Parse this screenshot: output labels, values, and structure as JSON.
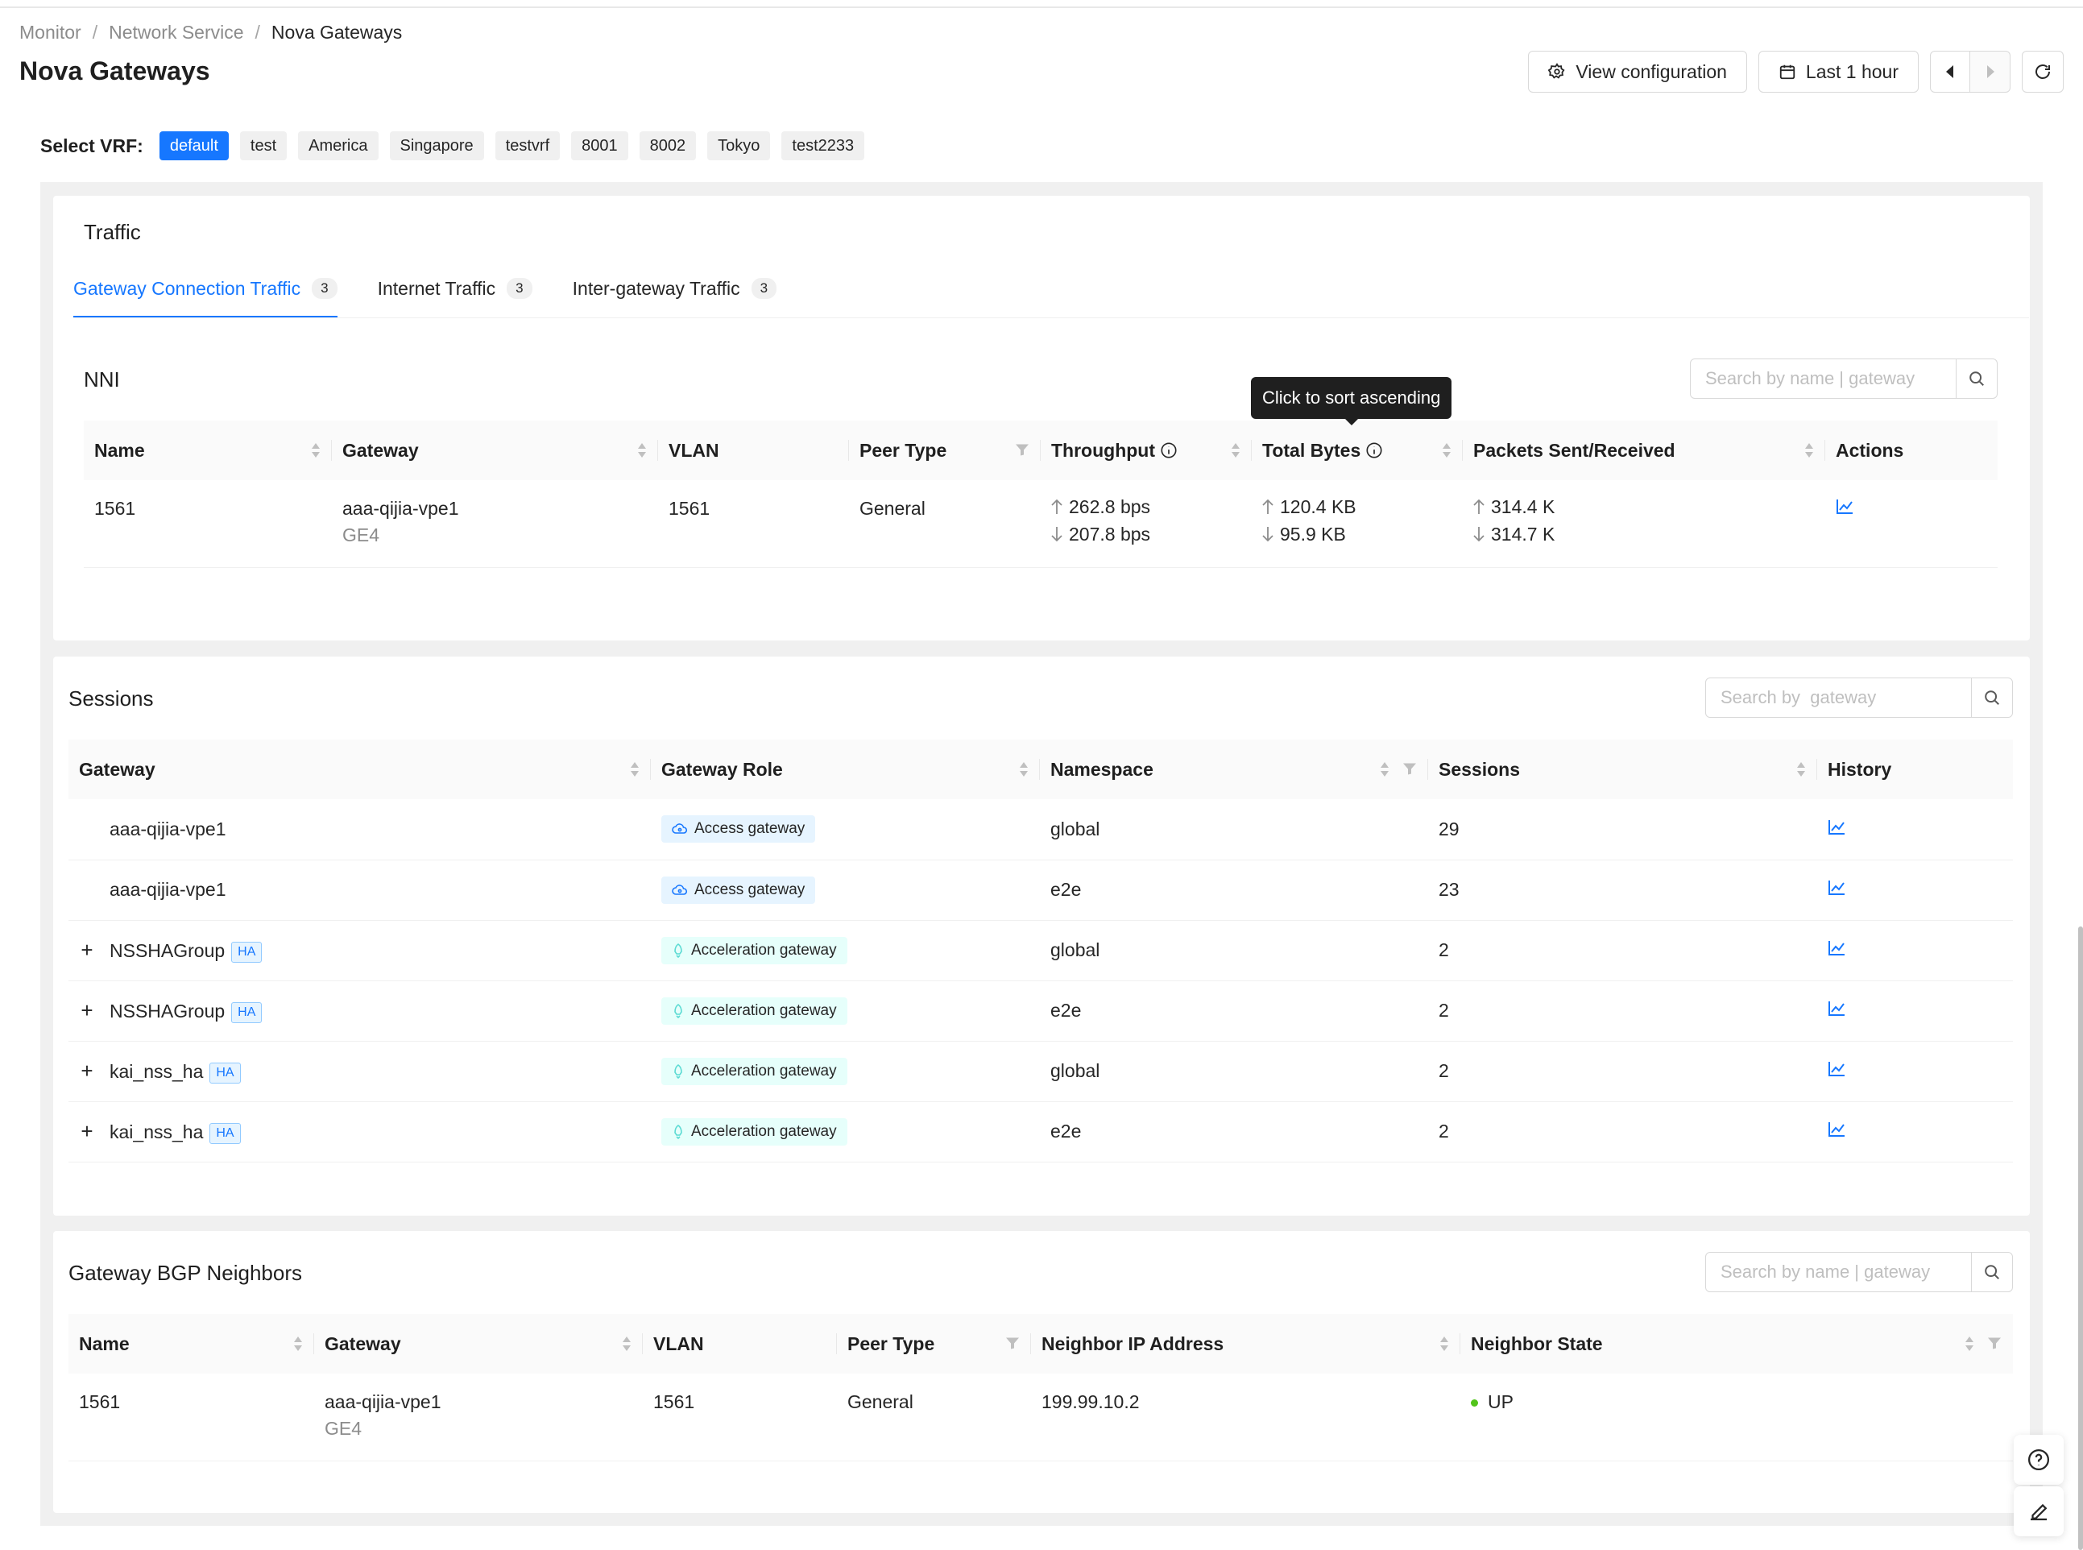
{
  "breadcrumb": {
    "items": [
      "Monitor",
      "Network Service",
      "Nova Gateways"
    ],
    "separator": "/"
  },
  "page": {
    "title": "Nova Gateways"
  },
  "toolbar": {
    "view_config_label": "View configuration",
    "time_range_label": "Last 1 hour"
  },
  "vrf": {
    "label": "Select VRF:",
    "options": [
      "default",
      "test",
      "America",
      "Singapore",
      "testvrf",
      "8001",
      "8002",
      "Tokyo",
      "test2233"
    ],
    "selected": "default"
  },
  "traffic": {
    "title": "Traffic",
    "tabs": [
      {
        "label": "Gateway Connection Traffic",
        "count": "3"
      },
      {
        "label": "Internet Traffic",
        "count": "3"
      },
      {
        "label": "Inter-gateway Traffic",
        "count": "3"
      }
    ],
    "nni": {
      "title": "NNI",
      "search_placeholder": "Search by name | gateway",
      "tooltip": "Click to sort ascending",
      "columns": [
        "Name",
        "Gateway",
        "VLAN",
        "Peer Type",
        "Throughput",
        "Total Bytes",
        "Packets Sent/Received",
        "Actions"
      ],
      "rows": [
        {
          "name": "1561",
          "gateway": "aaa-qijia-vpe1",
          "gateway_sub": "GE4",
          "vlan": "1561",
          "peer_type": "General",
          "throughput_up": "262.8 bps",
          "throughput_down": "207.8 bps",
          "bytes_up": "120.4 KB",
          "bytes_down": "95.9 KB",
          "packets_up": "314.4 K",
          "packets_down": "314.7 K"
        }
      ]
    }
  },
  "sessions": {
    "title": "Sessions",
    "search_placeholder": "Search by  gateway",
    "columns": [
      "Gateway",
      "Gateway Role",
      "Namespace",
      "Sessions",
      "History"
    ],
    "rows": [
      {
        "expand": "",
        "gateway": "aaa-qijia-vpe1",
        "ha": "",
        "role": "Access gateway",
        "role_type": "access",
        "namespace": "global",
        "sessions": "29"
      },
      {
        "expand": "",
        "gateway": "aaa-qijia-vpe1",
        "ha": "",
        "role": "Access gateway",
        "role_type": "access",
        "namespace": "e2e",
        "sessions": "23"
      },
      {
        "expand": "+",
        "gateway": "NSSHAGroup",
        "ha": "HA",
        "role": "Acceleration gateway",
        "role_type": "accel",
        "namespace": "global",
        "sessions": "2"
      },
      {
        "expand": "+",
        "gateway": "NSSHAGroup",
        "ha": "HA",
        "role": "Acceleration gateway",
        "role_type": "accel",
        "namespace": "e2e",
        "sessions": "2"
      },
      {
        "expand": "+",
        "gateway": "kai_nss_ha",
        "ha": "HA",
        "role": "Acceleration gateway",
        "role_type": "accel",
        "namespace": "global",
        "sessions": "2"
      },
      {
        "expand": "+",
        "gateway": "kai_nss_ha",
        "ha": "HA",
        "role": "Acceleration gateway",
        "role_type": "accel",
        "namespace": "e2e",
        "sessions": "2"
      }
    ]
  },
  "bgp": {
    "title": "Gateway BGP Neighbors",
    "search_placeholder": "Search by name | gateway",
    "columns": [
      "Name",
      "Gateway",
      "VLAN",
      "Peer Type",
      "Neighbor IP Address",
      "Neighbor State"
    ],
    "rows": [
      {
        "name": "1561",
        "gateway": "aaa-qijia-vpe1",
        "gateway_sub": "GE4",
        "vlan": "1561",
        "peer_type": "General",
        "neighbor_ip": "199.99.10.2",
        "state": "UP"
      }
    ]
  },
  "colors": {
    "accent": "#1677ff",
    "status_up": "#52c41a",
    "tag_access_bg": "#e6f4ff",
    "tag_accel_bg": "#e6fffb"
  },
  "icons": {
    "view_config": "gear-icon",
    "time_range": "calendar-icon",
    "prev": "caret-left-icon",
    "next": "caret-right-icon",
    "refresh": "refresh-icon",
    "search": "search-icon",
    "history": "line-chart-icon",
    "help": "help-icon",
    "edit": "edit-icon"
  }
}
